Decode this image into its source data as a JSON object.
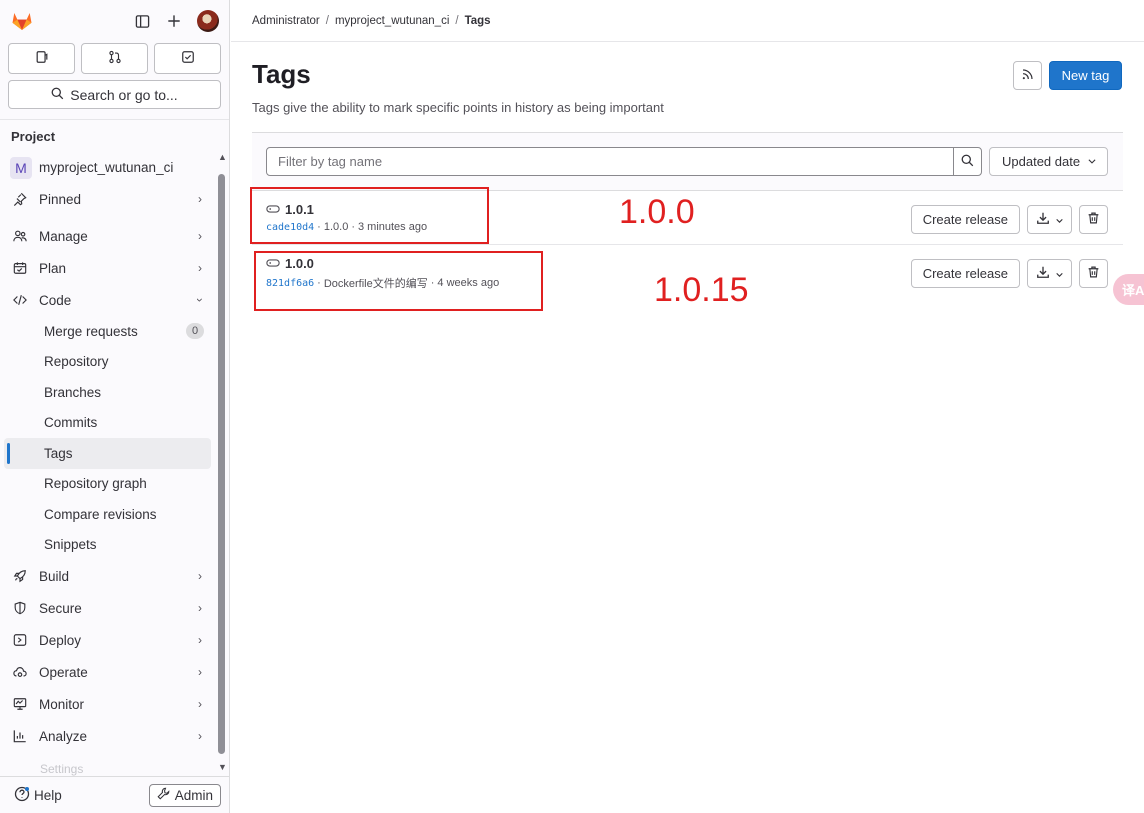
{
  "sidebar": {
    "quick_actions": [
      "issues-icon",
      "merge-requests-icon",
      "todo-icon"
    ],
    "search_label": "Search or go to...",
    "section_title": "Project",
    "project": {
      "avatar_letter": "M",
      "name": "myproject_wutunan_ci"
    },
    "items": {
      "pinned": "Pinned",
      "manage": "Manage",
      "plan": "Plan",
      "code": "Code",
      "build": "Build",
      "secure": "Secure",
      "deploy": "Deploy",
      "operate": "Operate",
      "monitor": "Monitor",
      "analyze": "Analyze",
      "settings": "Settings"
    },
    "code_sub": {
      "merge_requests": "Merge requests",
      "merge_requests_count": "0",
      "repository": "Repository",
      "branches": "Branches",
      "commits": "Commits",
      "tags": "Tags",
      "repository_graph": "Repository graph",
      "compare_revisions": "Compare revisions",
      "snippets": "Snippets"
    },
    "help_label": "Help",
    "admin_label": "Admin"
  },
  "breadcrumb": {
    "items": [
      "Administrator",
      "myproject_wutunan_ci",
      "Tags"
    ],
    "separator": "/"
  },
  "header": {
    "title": "Tags",
    "description": "Tags give the ability to mark specific points in history as being important",
    "new_tag_label": "New tag"
  },
  "filter": {
    "placeholder": "Filter by tag name",
    "sort_label": "Updated date"
  },
  "tags": [
    {
      "name": "1.0.1",
      "sha": "cade10d4",
      "message": "1.0.0",
      "time": "3 minutes ago"
    },
    {
      "name": "1.0.0",
      "sha": "821df6a6",
      "message": "Dockerfile文件的编写",
      "time": "4 weeks ago"
    }
  ],
  "row_actions": {
    "create_release": "Create release"
  },
  "meta_separator": "·",
  "annotations": {
    "first": "1.0.0",
    "second": "1.0.15"
  },
  "translate_fab": "译A",
  "colors": {
    "accent": "#1f75cb",
    "annotation": "#e02020",
    "active_indicator": "#1f75cb"
  }
}
